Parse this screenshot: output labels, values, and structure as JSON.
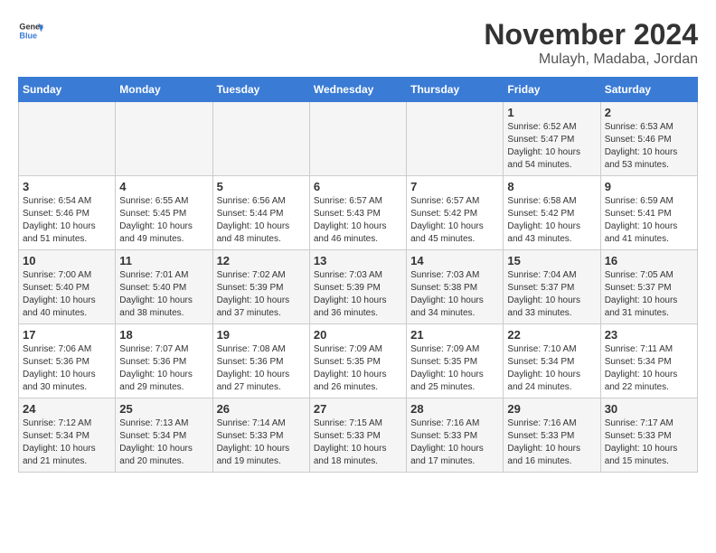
{
  "logo": {
    "text_general": "General",
    "text_blue": "Blue"
  },
  "header": {
    "month": "November 2024",
    "location": "Mulayh, Madaba, Jordan"
  },
  "weekdays": [
    "Sunday",
    "Monday",
    "Tuesday",
    "Wednesday",
    "Thursday",
    "Friday",
    "Saturday"
  ],
  "weeks": [
    [
      {
        "day": "",
        "info": ""
      },
      {
        "day": "",
        "info": ""
      },
      {
        "day": "",
        "info": ""
      },
      {
        "day": "",
        "info": ""
      },
      {
        "day": "",
        "info": ""
      },
      {
        "day": "1",
        "info": "Sunrise: 6:52 AM\nSunset: 5:47 PM\nDaylight: 10 hours and 54 minutes."
      },
      {
        "day": "2",
        "info": "Sunrise: 6:53 AM\nSunset: 5:46 PM\nDaylight: 10 hours and 53 minutes."
      }
    ],
    [
      {
        "day": "3",
        "info": "Sunrise: 6:54 AM\nSunset: 5:46 PM\nDaylight: 10 hours and 51 minutes."
      },
      {
        "day": "4",
        "info": "Sunrise: 6:55 AM\nSunset: 5:45 PM\nDaylight: 10 hours and 49 minutes."
      },
      {
        "day": "5",
        "info": "Sunrise: 6:56 AM\nSunset: 5:44 PM\nDaylight: 10 hours and 48 minutes."
      },
      {
        "day": "6",
        "info": "Sunrise: 6:57 AM\nSunset: 5:43 PM\nDaylight: 10 hours and 46 minutes."
      },
      {
        "day": "7",
        "info": "Sunrise: 6:57 AM\nSunset: 5:42 PM\nDaylight: 10 hours and 45 minutes."
      },
      {
        "day": "8",
        "info": "Sunrise: 6:58 AM\nSunset: 5:42 PM\nDaylight: 10 hours and 43 minutes."
      },
      {
        "day": "9",
        "info": "Sunrise: 6:59 AM\nSunset: 5:41 PM\nDaylight: 10 hours and 41 minutes."
      }
    ],
    [
      {
        "day": "10",
        "info": "Sunrise: 7:00 AM\nSunset: 5:40 PM\nDaylight: 10 hours and 40 minutes."
      },
      {
        "day": "11",
        "info": "Sunrise: 7:01 AM\nSunset: 5:40 PM\nDaylight: 10 hours and 38 minutes."
      },
      {
        "day": "12",
        "info": "Sunrise: 7:02 AM\nSunset: 5:39 PM\nDaylight: 10 hours and 37 minutes."
      },
      {
        "day": "13",
        "info": "Sunrise: 7:03 AM\nSunset: 5:39 PM\nDaylight: 10 hours and 36 minutes."
      },
      {
        "day": "14",
        "info": "Sunrise: 7:03 AM\nSunset: 5:38 PM\nDaylight: 10 hours and 34 minutes."
      },
      {
        "day": "15",
        "info": "Sunrise: 7:04 AM\nSunset: 5:37 PM\nDaylight: 10 hours and 33 minutes."
      },
      {
        "day": "16",
        "info": "Sunrise: 7:05 AM\nSunset: 5:37 PM\nDaylight: 10 hours and 31 minutes."
      }
    ],
    [
      {
        "day": "17",
        "info": "Sunrise: 7:06 AM\nSunset: 5:36 PM\nDaylight: 10 hours and 30 minutes."
      },
      {
        "day": "18",
        "info": "Sunrise: 7:07 AM\nSunset: 5:36 PM\nDaylight: 10 hours and 29 minutes."
      },
      {
        "day": "19",
        "info": "Sunrise: 7:08 AM\nSunset: 5:36 PM\nDaylight: 10 hours and 27 minutes."
      },
      {
        "day": "20",
        "info": "Sunrise: 7:09 AM\nSunset: 5:35 PM\nDaylight: 10 hours and 26 minutes."
      },
      {
        "day": "21",
        "info": "Sunrise: 7:09 AM\nSunset: 5:35 PM\nDaylight: 10 hours and 25 minutes."
      },
      {
        "day": "22",
        "info": "Sunrise: 7:10 AM\nSunset: 5:34 PM\nDaylight: 10 hours and 24 minutes."
      },
      {
        "day": "23",
        "info": "Sunrise: 7:11 AM\nSunset: 5:34 PM\nDaylight: 10 hours and 22 minutes."
      }
    ],
    [
      {
        "day": "24",
        "info": "Sunrise: 7:12 AM\nSunset: 5:34 PM\nDaylight: 10 hours and 21 minutes."
      },
      {
        "day": "25",
        "info": "Sunrise: 7:13 AM\nSunset: 5:34 PM\nDaylight: 10 hours and 20 minutes."
      },
      {
        "day": "26",
        "info": "Sunrise: 7:14 AM\nSunset: 5:33 PM\nDaylight: 10 hours and 19 minutes."
      },
      {
        "day": "27",
        "info": "Sunrise: 7:15 AM\nSunset: 5:33 PM\nDaylight: 10 hours and 18 minutes."
      },
      {
        "day": "28",
        "info": "Sunrise: 7:16 AM\nSunset: 5:33 PM\nDaylight: 10 hours and 17 minutes."
      },
      {
        "day": "29",
        "info": "Sunrise: 7:16 AM\nSunset: 5:33 PM\nDaylight: 10 hours and 16 minutes."
      },
      {
        "day": "30",
        "info": "Sunrise: 7:17 AM\nSunset: 5:33 PM\nDaylight: 10 hours and 15 minutes."
      }
    ]
  ]
}
